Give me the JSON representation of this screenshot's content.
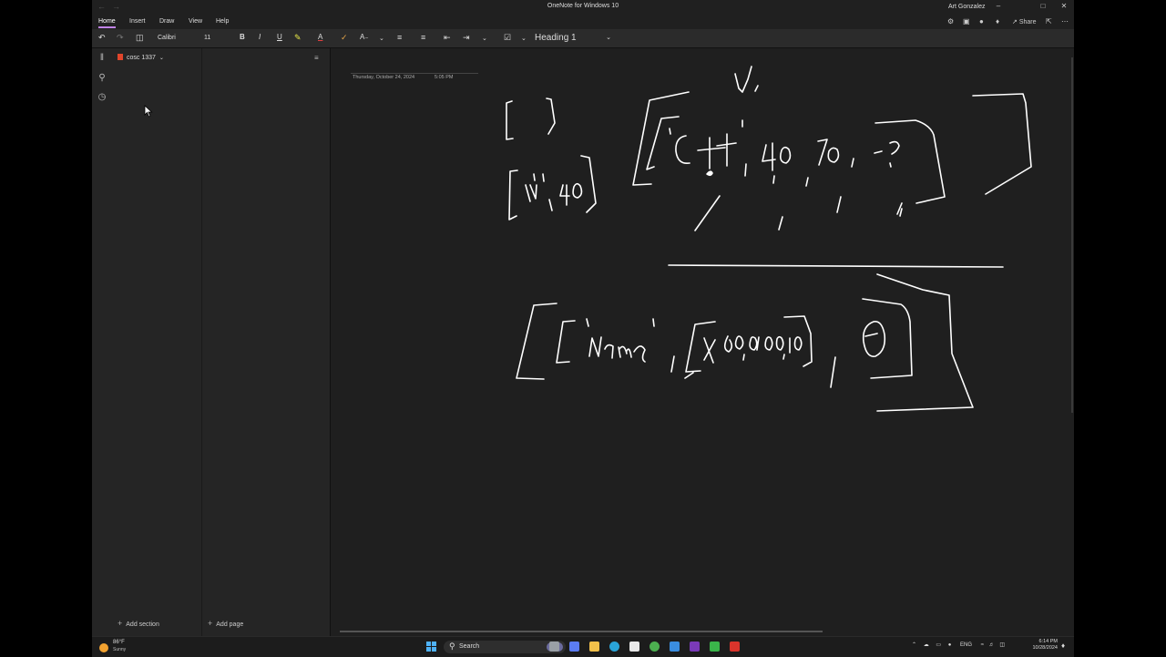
{
  "app": {
    "title": "OneNote for Windows 10",
    "user": "Art Gonzalez",
    "share_label": "Share"
  },
  "menu": {
    "items": [
      "Home",
      "Insert",
      "Draw",
      "View",
      "Help"
    ]
  },
  "ribbon": {
    "font_name": "Calibri",
    "font_size": "11",
    "style": "Heading 1",
    "bold": "B",
    "italic": "I",
    "underline": "U",
    "font_color": "A"
  },
  "notebook": {
    "name": "cosc 1337",
    "add_section": "Add section",
    "add_page": "Add page"
  },
  "page": {
    "date": "Thursday, October 24, 2024",
    "time": "5:05 PM"
  },
  "taskbar": {
    "temperature": "86°F",
    "weather": "Sunny",
    "search_placeholder": "Search",
    "language": "ENG",
    "time": "6:14 PM",
    "date": "10/28/2024"
  },
  "colors": {
    "accent": "#c083e6",
    "notebook_icon": "#e0452b",
    "ink": "#ffffff"
  }
}
